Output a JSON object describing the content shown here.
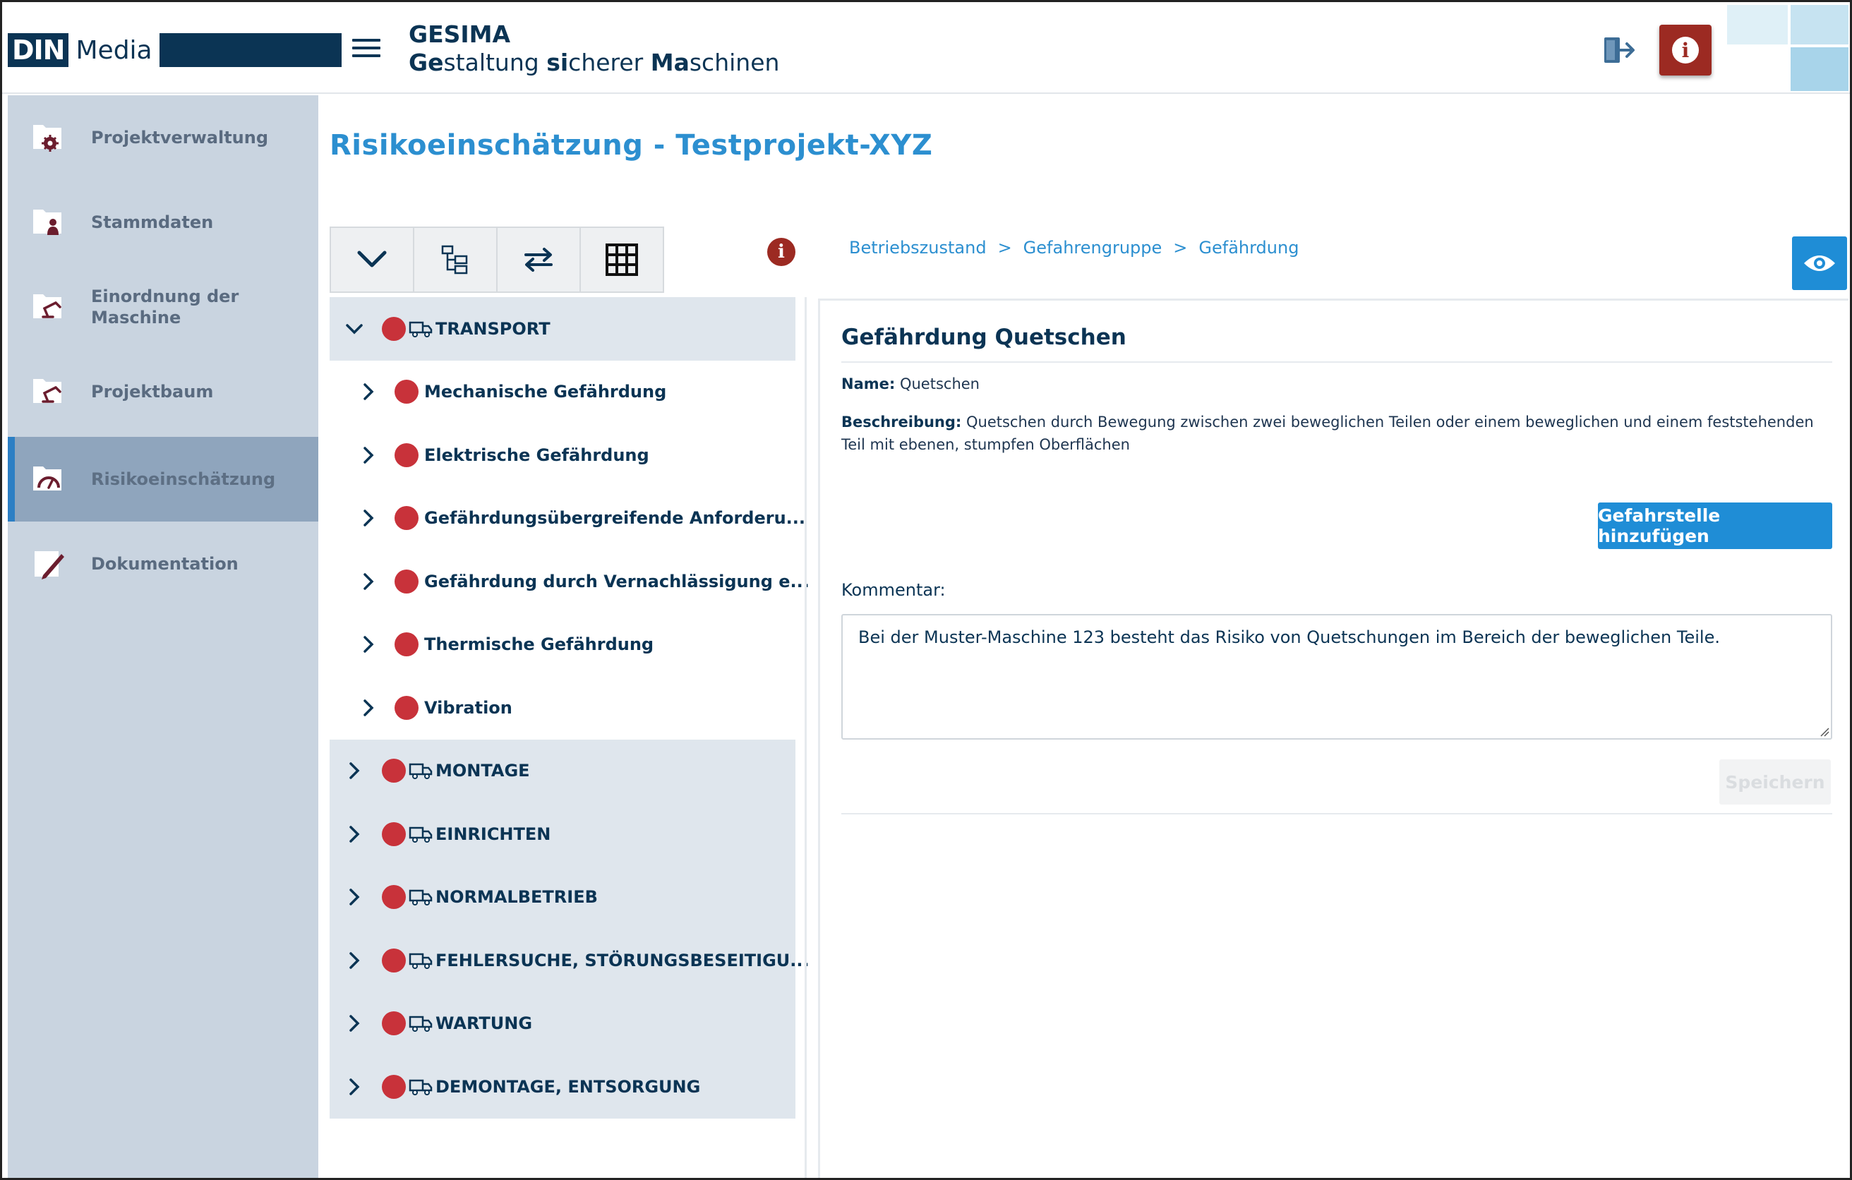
{
  "header": {
    "logo_din": "DIN",
    "logo_media": "Media",
    "app_name": "GESIMA",
    "subtitle_parts": [
      {
        "bold": "Ge",
        "rest": "staltung "
      },
      {
        "bold": "si",
        "rest": "cherer "
      },
      {
        "bold": "Ma",
        "rest": "schinen"
      }
    ],
    "info_glyph": "i"
  },
  "sidebar": {
    "items": [
      {
        "label": "Projektverwaltung",
        "icon": "folder-gear-icon",
        "active": false
      },
      {
        "label": "Stammdaten",
        "icon": "folder-person-icon",
        "active": false
      },
      {
        "label": "Einordnung der Maschine",
        "icon": "folder-robot-arm-icon",
        "active": false
      },
      {
        "label": "Projektbaum",
        "icon": "folder-robot-arm-icon",
        "active": false
      },
      {
        "label": "Risikoeinschätzung",
        "icon": "folder-gauge-icon",
        "active": true
      },
      {
        "label": "Dokumentation",
        "icon": "document-pen-icon",
        "active": false
      }
    ]
  },
  "main": {
    "page_title": "Risikoeinschätzung - Testprojekt-XYZ",
    "toolbar": [
      "chevron-down-icon",
      "tree-structure-icon",
      "swap-arrows-icon",
      "grid-icon"
    ],
    "info_glyph": "i",
    "breadcrumb": [
      "Betriebszustand",
      "Gefahrengruppe",
      "Gefährdung"
    ],
    "breadcrumb_sep": ">"
  },
  "tree": {
    "top_nodes": [
      {
        "label": "TRANSPORT",
        "expanded": true,
        "children": [
          "Mechanische Gefährdung",
          "Elektrische Gefährdung",
          "Gefährdungsübergreifende Anforderu...",
          "Gefährdung durch Vernachlässigung e...",
          "Thermische Gefährdung",
          "Vibration"
        ]
      },
      {
        "label": "MONTAGE",
        "expanded": false
      },
      {
        "label": "EINRICHTEN",
        "expanded": false
      },
      {
        "label": "NORMALBETRIEB",
        "expanded": false
      },
      {
        "label": "FEHLERSUCHE, STÖRUNGSBESEITIGU...",
        "expanded": false
      },
      {
        "label": "WARTUNG",
        "expanded": false
      },
      {
        "label": "DEMONTAGE, ENTSORGUNG",
        "expanded": false
      }
    ],
    "status_color": "#c8323a"
  },
  "detail": {
    "title": "Gefährdung Quetschen",
    "name_label": "Name:",
    "name_value": "Quetschen",
    "desc_label": "Beschreibung:",
    "desc_value": "Quetschen durch Bewegung zwischen zwei beweglichen Teilen oder einem beweglichen und einem feststehenden Teil mit ebenen, stumpfen Oberflächen",
    "add_button": "Gefahrstelle hinzufügen",
    "comment_label": "Kommentar:",
    "comment_value": "Bei der Muster-Maschine 123 besteht das Risiko von Quetschungen im Bereich der beweglichen Teile.",
    "save_button": "Speichern"
  },
  "colors": {
    "accent": "#1f8dd6",
    "navy": "#0b3454",
    "danger": "#9c2a22",
    "sidebar_bg": "#c9d4e0",
    "sidebar_active": "#8fa5bd"
  }
}
